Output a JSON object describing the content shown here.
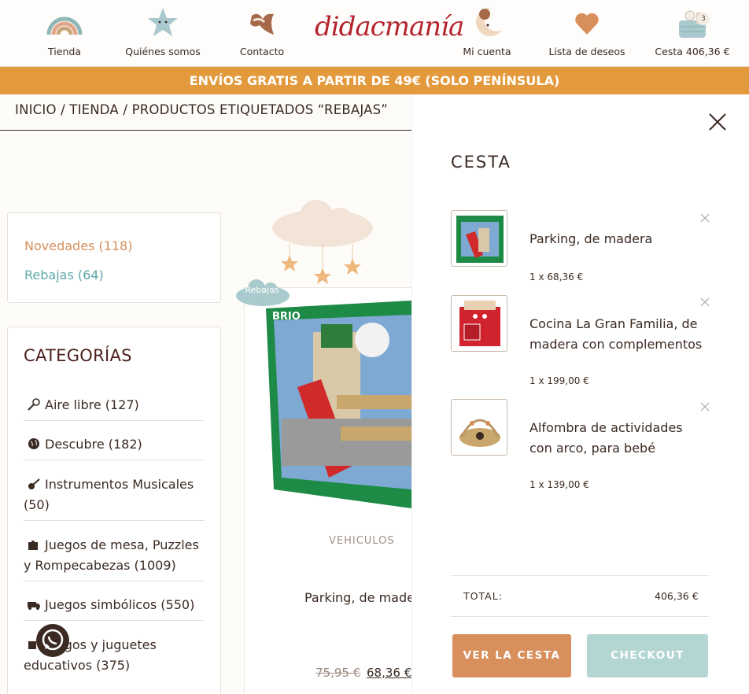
{
  "nav": {
    "tienda": "Tienda",
    "quienes": "Quiénes somos",
    "contacto": "Contacto",
    "logo": "didacmanía",
    "cuenta": "Mi cuenta",
    "deseos": "Lista de deseos",
    "cesta": "Cesta 406,36 €",
    "cesta_count": "3"
  },
  "promo": "ENVÍOS GRATIS A PARTIR DE 49€ (SOLO PENÍNSULA)",
  "breadcrumb": "INICIO / TIENDA / PRODUCTOS ETIQUETADOS “REBAJAS”",
  "tags": [
    {
      "label": "Novedades (118)",
      "color": "#d88f5c"
    },
    {
      "label": "Rebajas (64)",
      "color": "#5fa8a8"
    }
  ],
  "categories": {
    "title": "CATEGORÍAS",
    "items": [
      {
        "label": "Aire libre (127)",
        "icon": "badminton-icon"
      },
      {
        "label": "Descubre (182)",
        "icon": "globe-icon"
      },
      {
        "label": "Instrumentos Musicales (50)",
        "icon": "guitar-icon"
      },
      {
        "label": "Juegos de mesa, Puzzles y Rompecabezas (1009)",
        "icon": "puzzle-icon"
      },
      {
        "label": "Juegos simbólicos (550)",
        "icon": "truck-icon"
      },
      {
        "label": "Juegos y juguetes educativos (375)",
        "icon": "blocks-icon"
      }
    ]
  },
  "product": {
    "badge": "Rebajas",
    "category": "VEHICULOS",
    "name": "Parking, de madera",
    "old_price": "75,95 €",
    "price": "68,36 €"
  },
  "cart": {
    "title": "CESTA",
    "items": [
      {
        "name": "Parking, de madera",
        "qty": "1 x 68,36 €"
      },
      {
        "name": "Cocina La Gran Familia, de madera con complementos",
        "qty": "1 x 199,00 €"
      },
      {
        "name": "Alfombra de actividades con arco, para bebé",
        "qty": "1 x 139,00 €"
      }
    ],
    "total_label": "TOTAL:",
    "total_value": "406,36 €",
    "view_cart": "VER LA CESTA",
    "checkout": "CHECKOUT"
  },
  "colors": {
    "promo": "#e39a3d",
    "view_cart": "#d88f5c",
    "checkout": "#b4d6d2",
    "logo": "#b4232e"
  }
}
